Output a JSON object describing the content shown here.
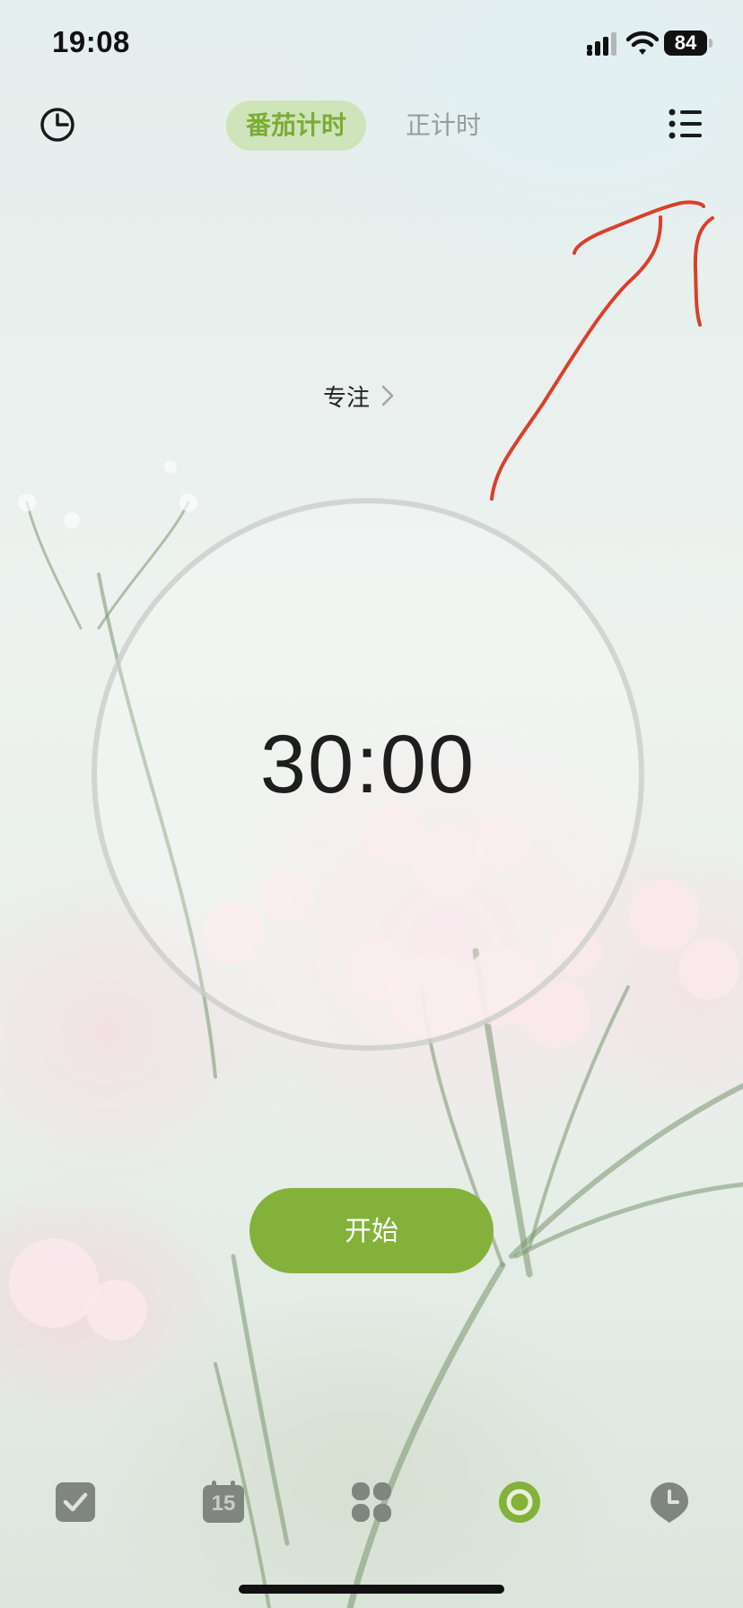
{
  "status_bar": {
    "time": "19:08",
    "battery": "84"
  },
  "header": {
    "history_icon": "history-clock-icon",
    "tabs": [
      {
        "label": "番茄计时",
        "active": true
      },
      {
        "label": "正计时",
        "active": false
      }
    ],
    "menu_icon": "list-settings-icon"
  },
  "focus": {
    "label": "专注"
  },
  "timer": {
    "value": "30:00"
  },
  "start_button": {
    "label": "开始"
  },
  "bottom_nav": {
    "items": [
      {
        "name": "tasks",
        "icon": "checkbox-icon"
      },
      {
        "name": "calendar",
        "icon": "calendar-icon",
        "label": "15"
      },
      {
        "name": "matrix",
        "icon": "four-quadrant-icon"
      },
      {
        "name": "pomodoro",
        "icon": "pomodoro-ring-icon",
        "active": true
      },
      {
        "name": "habit",
        "icon": "clock-pin-icon"
      }
    ]
  },
  "colors": {
    "accent": "#84b13a",
    "tab_active_bg": "#cbe2b2",
    "tab_active_text": "#7aac35",
    "annotation": "#d9402a"
  }
}
